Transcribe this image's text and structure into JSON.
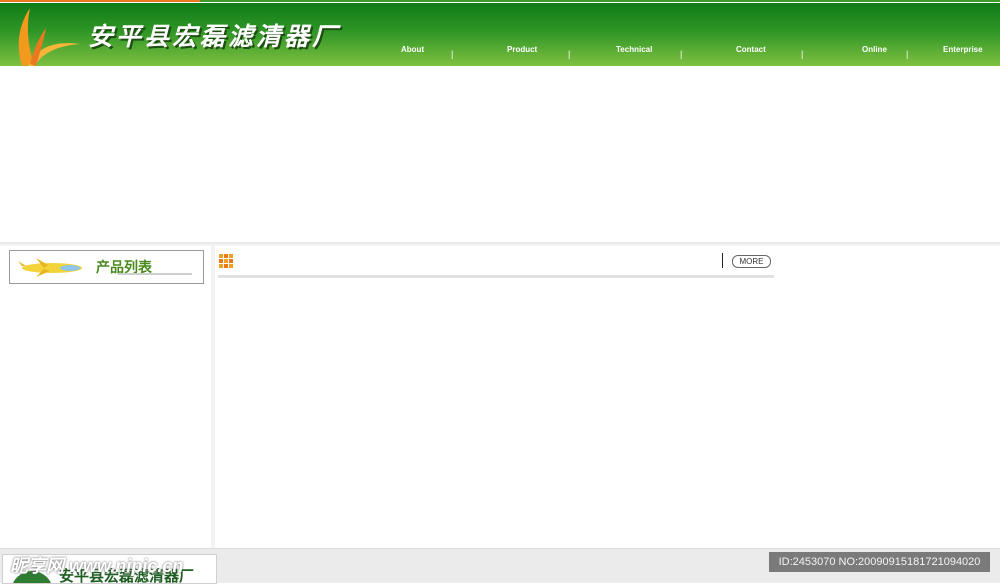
{
  "header": {
    "brand": "安平县宏磊滤清器厂",
    "nav": [
      "About",
      "Product",
      "Technical",
      "Contact",
      "Online",
      "Enterprise"
    ],
    "nav_separator": "|"
  },
  "sidebar": {
    "product_list_title": "产品列表"
  },
  "main": {
    "more_label": "MORE"
  },
  "footer": {
    "brand": "安平县宏磊滤清器厂"
  },
  "watermark": {
    "site": "昵享网 www.nipic.cn",
    "id_text": "ID:2453070 NO:20090915181721094020"
  },
  "colors": {
    "accent_orange": "#e8791e",
    "header_green": "#2f9626",
    "title_green": "#4a8a1c"
  }
}
